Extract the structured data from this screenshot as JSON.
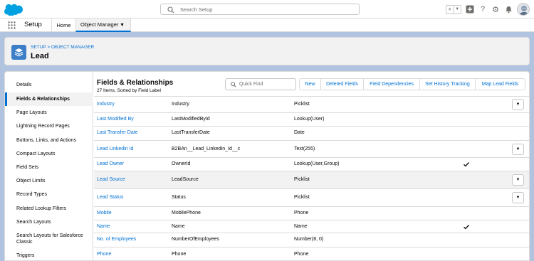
{
  "header": {
    "search_placeholder": "Search Setup",
    "icons": [
      "salesforce-cloud-logo",
      "star-icon",
      "add-icon",
      "help-icon",
      "gear-icon",
      "bell-icon",
      "user-avatar"
    ]
  },
  "nav": {
    "app_name": "Setup",
    "tabs": [
      {
        "label": "Home"
      },
      {
        "label": "Object Manager",
        "active": true
      }
    ]
  },
  "page_header": {
    "breadcrumb": "SETUP > OBJECT MANAGER",
    "title": "Lead"
  },
  "sidebar": {
    "items": [
      {
        "label": "Details"
      },
      {
        "label": "Fields & Relationships",
        "active": true
      },
      {
        "label": "Page Layouts"
      },
      {
        "label": "Lightning Record Pages"
      },
      {
        "label": "Buttons, Links, and Actions"
      },
      {
        "label": "Compact Layouts"
      },
      {
        "label": "Field Sets"
      },
      {
        "label": "Object Limits"
      },
      {
        "label": "Record Types"
      },
      {
        "label": "Related Lookup Filters"
      },
      {
        "label": "Search Layouts"
      },
      {
        "label": "Search Layouts for Salesforce Classic"
      },
      {
        "label": "Triggers"
      }
    ]
  },
  "content": {
    "title": "Fields & Relationships",
    "subtitle": "27 Items, Sorted by Field Label",
    "quick_find_placeholder": "Quick Find",
    "buttons": [
      "New",
      "Deleted Fields",
      "Field Dependencies",
      "Set History Tracking",
      "Map Lead Fields"
    ],
    "rows": [
      {
        "label": "Industry",
        "api": "Industry",
        "type": "Picklist",
        "indexed": false,
        "dropdown": true
      },
      {
        "label": "Last Modified By",
        "api": "LastModifiedById",
        "type": "Lookup(User)",
        "indexed": false,
        "dropdown": false
      },
      {
        "label": "Last Transfer Date",
        "api": "LastTransferDate",
        "type": "Date",
        "indexed": false,
        "dropdown": false
      },
      {
        "label": "Lead Linkedin Id",
        "api": "B2BAn__Lead_Linkedin_Id__c",
        "type": "Text(255)",
        "indexed": false,
        "dropdown": true
      },
      {
        "label": "Lead Owner",
        "api": "OwnerId",
        "type": "Lookup(User,Group)",
        "indexed": true,
        "dropdown": false
      },
      {
        "label": "Lead Source",
        "api": "LeadSource",
        "type": "Picklist",
        "indexed": false,
        "dropdown": true,
        "highlight": true
      },
      {
        "label": "Lead Status",
        "api": "Status",
        "type": "Picklist",
        "indexed": false,
        "dropdown": true
      },
      {
        "label": "Mobile",
        "api": "MobilePhone",
        "type": "Phone",
        "indexed": false,
        "dropdown": false
      },
      {
        "label": "Name",
        "api": "Name",
        "type": "Name",
        "indexed": true,
        "dropdown": false
      },
      {
        "label": "No. of Employees",
        "api": "NumberOfEmployees",
        "type": "Number(8, 0)",
        "indexed": false,
        "dropdown": false
      },
      {
        "label": "Phone",
        "api": "Phone",
        "type": "Phone",
        "indexed": false,
        "dropdown": false
      }
    ]
  },
  "colors": {
    "brand_blue": "#0070d2",
    "background": "#b0c4df",
    "object_icon": "#3c7fc8",
    "border": "#dddbda"
  }
}
